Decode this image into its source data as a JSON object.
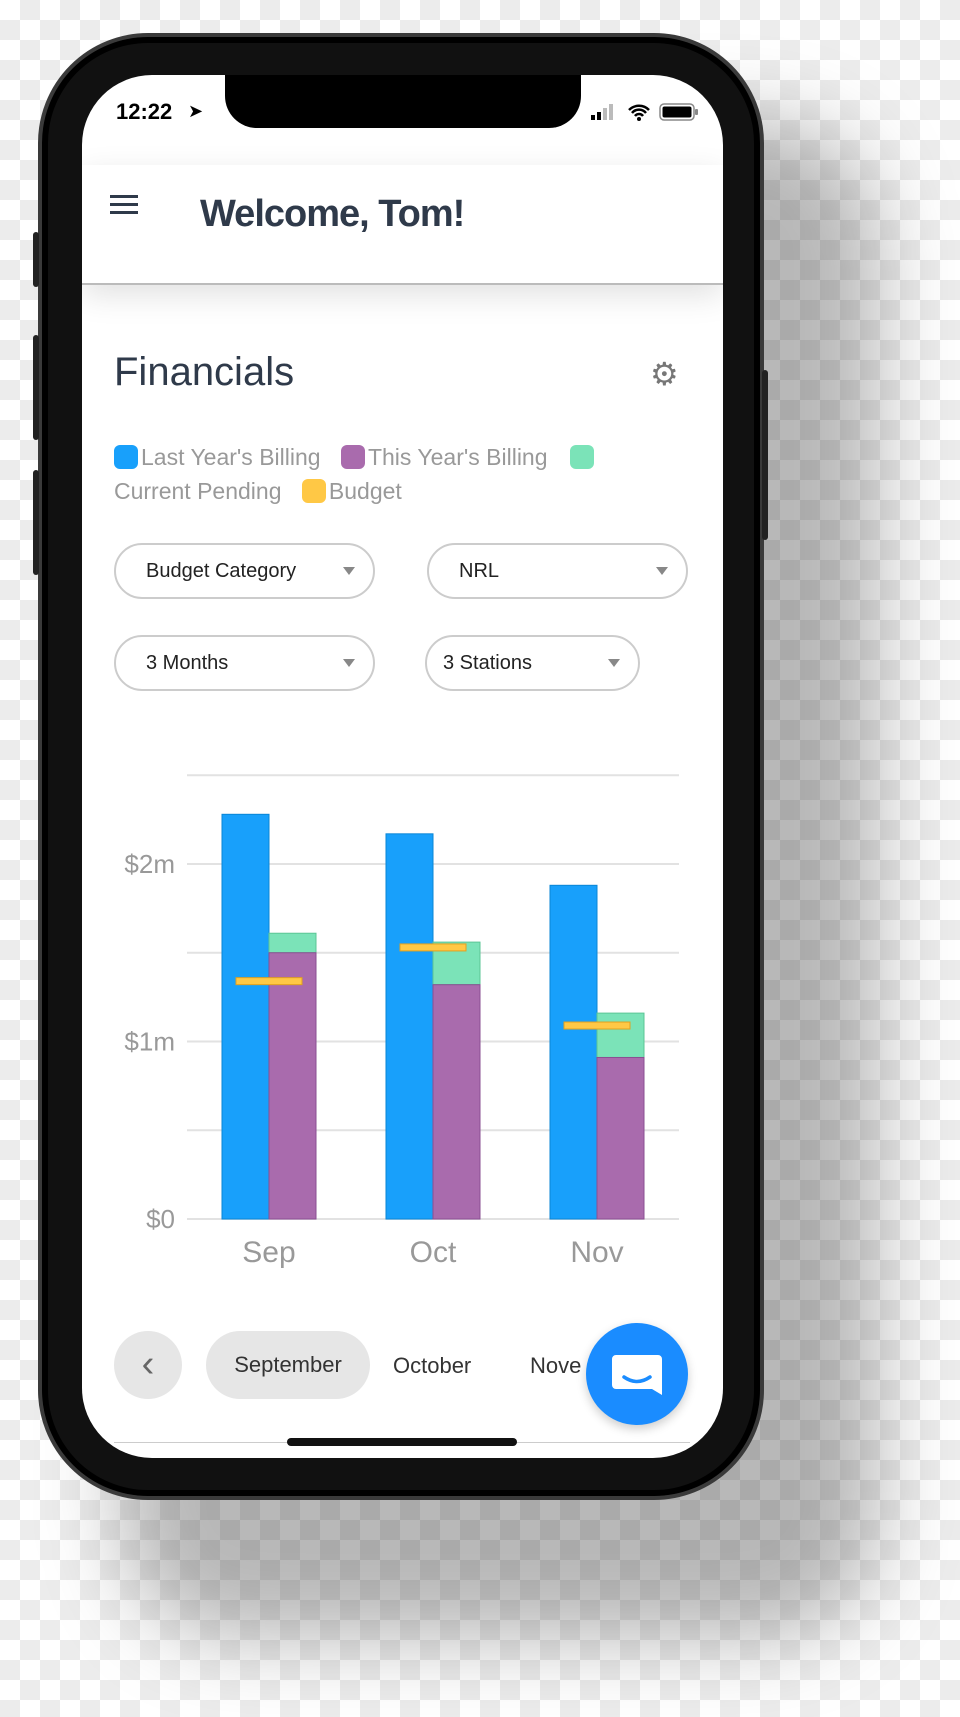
{
  "status_bar": {
    "time": "12:22"
  },
  "header": {
    "title": "Welcome, Tom!"
  },
  "section": {
    "title": "Financials"
  },
  "legend": [
    {
      "label": "Last Year's Billing",
      "color": "#18a0fb"
    },
    {
      "label": "This Year's Billing",
      "color": "#a96bad"
    },
    {
      "label": "Current Pending",
      "color": "#7be3b8"
    },
    {
      "label": "Budget",
      "color": "#ffc845"
    }
  ],
  "filters": {
    "category": "Budget Category",
    "group": "NRL",
    "period": "3 Months",
    "stations": "3 Stations"
  },
  "chart_data": {
    "type": "bar",
    "categories": [
      "Sep",
      "Oct",
      "Nov"
    ],
    "ylim": [
      0,
      2.5
    ],
    "yticks": [
      {
        "v": 0,
        "label": "$0"
      },
      {
        "v": 1,
        "label": "$1m"
      },
      {
        "v": 2,
        "label": "$2m"
      }
    ],
    "gridlines": [
      0,
      0.5,
      1,
      1.5,
      2,
      2.5
    ],
    "unit": "$m",
    "series": [
      {
        "name": "Last Year's Billing",
        "color": "#18a0fb",
        "values": [
          2.28,
          2.17,
          1.88
        ]
      },
      {
        "name": "This Year's Billing",
        "color": "#a96bad",
        "values": [
          1.5,
          1.32,
          0.91
        ]
      },
      {
        "name": "Current Pending",
        "color": "#7be3b8",
        "values": [
          0.11,
          0.24,
          0.25
        ],
        "stacked_on": "This Year's Billing"
      },
      {
        "name": "Budget",
        "color": "#ffc845",
        "values": [
          1.34,
          1.53,
          1.09
        ],
        "marker": "line"
      }
    ]
  },
  "month_tabs": {
    "selected": "September",
    "items": [
      "September",
      "October",
      "Nove"
    ]
  }
}
